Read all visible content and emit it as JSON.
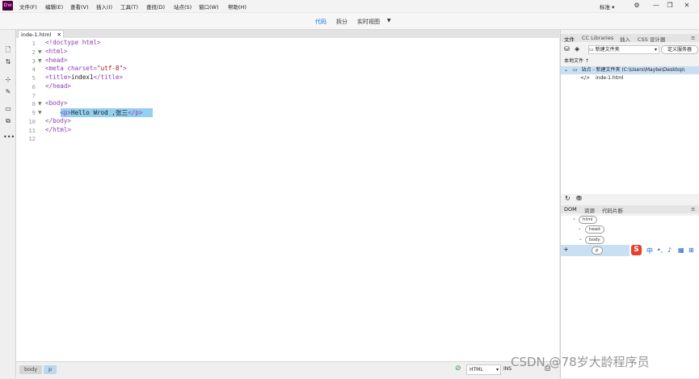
{
  "menubar": {
    "logo": "Dw",
    "items": [
      "文件(F)",
      "编辑(E)",
      "查看(V)",
      "插入(I)",
      "工具(T)",
      "查找(D)",
      "站点(S)",
      "窗口(W)",
      "帮助(H)"
    ],
    "workspace": "标准"
  },
  "viewbar": {
    "tabs": [
      "代码",
      "拆分",
      "实时视图"
    ],
    "active": "代码"
  },
  "document": {
    "tab_label": "inde-1.html",
    "lines": [
      {
        "n": "1",
        "fold": "",
        "html": "&lt;!doctype html&gt;"
      },
      {
        "n": "2",
        "fold": "▼",
        "html": "&lt;html&gt;"
      },
      {
        "n": "3",
        "fold": "▼",
        "html": "&lt;head&gt;"
      },
      {
        "n": "4",
        "fold": "",
        "html": "&lt;meta charset=\"utf-8\"&gt;"
      },
      {
        "n": "5",
        "fold": "",
        "html": "&lt;title&gt;index1&lt;/title&gt;"
      },
      {
        "n": "6",
        "fold": "",
        "html": "&lt;/head&gt;"
      },
      {
        "n": "7",
        "fold": "",
        "html": ""
      },
      {
        "n": "8",
        "fold": "▼",
        "html": "&lt;body&gt;"
      },
      {
        "n": "9",
        "fold": "▼",
        "html": "    &lt;p&gt;Hello Wrod ,张三&lt;/p&gt;"
      },
      {
        "n": "10",
        "fold": "",
        "html": "&lt;/body&gt;"
      },
      {
        "n": "11",
        "fold": "",
        "html": "&lt;/html&gt;"
      },
      {
        "n": "12",
        "fold": "",
        "html": ""
      }
    ]
  },
  "status": {
    "crumbs": [
      "body",
      "p"
    ],
    "language": "HTML",
    "mode": "INS"
  },
  "files_panel": {
    "tabs": [
      "文件",
      "CC Libraries",
      "插入",
      "CSS 设计器"
    ],
    "folder_select": "新建文件夹",
    "define_server": "定义服务器",
    "local_files_label": "本地文件",
    "site_row": "站点 - 新建文件夹 (C:\\Users\\Maybe\\Desktop\\",
    "file_row": "inde-1.html"
  },
  "dom_panel": {
    "tabs": [
      "DOM",
      "资源",
      "代码片断"
    ],
    "nodes": [
      "html",
      "head",
      "body",
      "p"
    ]
  },
  "ime": {
    "label": "中"
  },
  "watermark": "CSDN @78岁大龄程序员"
}
